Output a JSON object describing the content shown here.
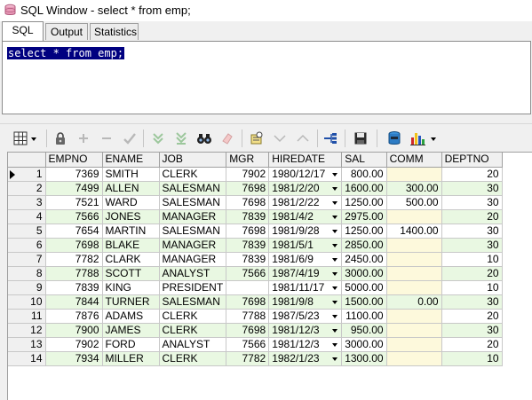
{
  "window": {
    "title": "SQL Window - select * from emp;"
  },
  "tabs": [
    {
      "label": "SQL",
      "active": true
    },
    {
      "label": "Output",
      "active": false
    },
    {
      "label": "Statistics",
      "active": false
    }
  ],
  "editor": {
    "sql": "select * from emp;"
  },
  "toolbar": {
    "icons": [
      "grid-menu-icon",
      "lock-icon",
      "add-record-icon",
      "delete-record-icon",
      "post-changes-icon",
      "fetch-next-icon",
      "fetch-last-icon",
      "find-icon",
      "clear-icon",
      "query-by-example-icon",
      "sort-down-icon",
      "sort-up-icon",
      "link-icon",
      "save-icon",
      "export-icon",
      "chart-icon"
    ]
  },
  "grid": {
    "columns": [
      "EMPNO",
      "ENAME",
      "JOB",
      "MGR",
      "HIREDATE",
      "SAL",
      "COMM",
      "DEPTNO"
    ],
    "rows": [
      {
        "n": "1",
        "empno": "7369",
        "ename": "SMITH",
        "job": "CLERK",
        "mgr": "7902",
        "hiredate": "1980/12/17",
        "sal": "800.00",
        "comm": "",
        "deptno": "20"
      },
      {
        "n": "2",
        "empno": "7499",
        "ename": "ALLEN",
        "job": "SALESMAN",
        "mgr": "7698",
        "hiredate": "1981/2/20",
        "sal": "1600.00",
        "comm": "300.00",
        "deptno": "30"
      },
      {
        "n": "3",
        "empno": "7521",
        "ename": "WARD",
        "job": "SALESMAN",
        "mgr": "7698",
        "hiredate": "1981/2/22",
        "sal": "1250.00",
        "comm": "500.00",
        "deptno": "30"
      },
      {
        "n": "4",
        "empno": "7566",
        "ename": "JONES",
        "job": "MANAGER",
        "mgr": "7839",
        "hiredate": "1981/4/2",
        "sal": "2975.00",
        "comm": "",
        "deptno": "20"
      },
      {
        "n": "5",
        "empno": "7654",
        "ename": "MARTIN",
        "job": "SALESMAN",
        "mgr": "7698",
        "hiredate": "1981/9/28",
        "sal": "1250.00",
        "comm": "1400.00",
        "deptno": "30"
      },
      {
        "n": "6",
        "empno": "7698",
        "ename": "BLAKE",
        "job": "MANAGER",
        "mgr": "7839",
        "hiredate": "1981/5/1",
        "sal": "2850.00",
        "comm": "",
        "deptno": "30"
      },
      {
        "n": "7",
        "empno": "7782",
        "ename": "CLARK",
        "job": "MANAGER",
        "mgr": "7839",
        "hiredate": "1981/6/9",
        "sal": "2450.00",
        "comm": "",
        "deptno": "10"
      },
      {
        "n": "8",
        "empno": "7788",
        "ename": "SCOTT",
        "job": "ANALYST",
        "mgr": "7566",
        "hiredate": "1987/4/19",
        "sal": "3000.00",
        "comm": "",
        "deptno": "20"
      },
      {
        "n": "9",
        "empno": "7839",
        "ename": "KING",
        "job": "PRESIDENT",
        "mgr": "",
        "hiredate": "1981/11/17",
        "sal": "5000.00",
        "comm": "",
        "deptno": "10"
      },
      {
        "n": "10",
        "empno": "7844",
        "ename": "TURNER",
        "job": "SALESMAN",
        "mgr": "7698",
        "hiredate": "1981/9/8",
        "sal": "1500.00",
        "comm": "0.00",
        "deptno": "30"
      },
      {
        "n": "11",
        "empno": "7876",
        "ename": "ADAMS",
        "job": "CLERK",
        "mgr": "7788",
        "hiredate": "1987/5/23",
        "sal": "1100.00",
        "comm": "",
        "deptno": "20"
      },
      {
        "n": "12",
        "empno": "7900",
        "ename": "JAMES",
        "job": "CLERK",
        "mgr": "7698",
        "hiredate": "1981/12/3",
        "sal": "950.00",
        "comm": "",
        "deptno": "30"
      },
      {
        "n": "13",
        "empno": "7902",
        "ename": "FORD",
        "job": "ANALYST",
        "mgr": "7566",
        "hiredate": "1981/12/3",
        "sal": "3000.00",
        "comm": "",
        "deptno": "20"
      },
      {
        "n": "14",
        "empno": "7934",
        "ename": "MILLER",
        "job": "CLERK",
        "mgr": "7782",
        "hiredate": "1982/1/23",
        "sal": "1300.00",
        "comm": "",
        "deptno": "10"
      }
    ]
  },
  "colors": {
    "selection": "#000080",
    "even_row": "#e9f8e2",
    "null_cell": "#fdf9dc"
  }
}
